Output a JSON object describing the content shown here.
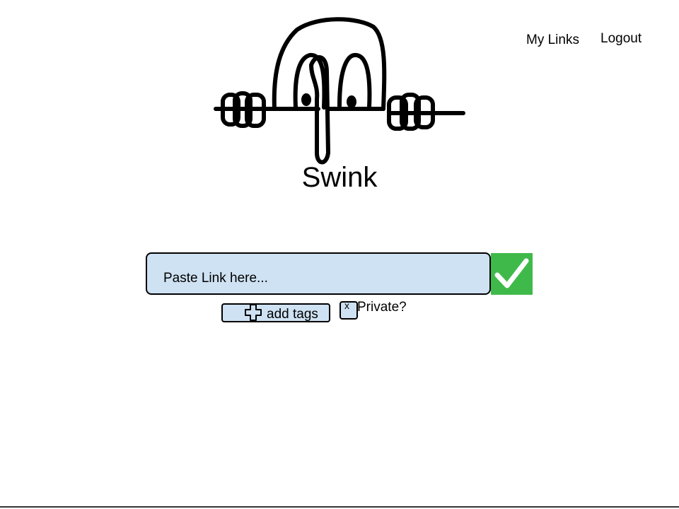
{
  "app": {
    "name": "Swink"
  },
  "nav": {
    "my_links": "My Links",
    "logout": "Logout"
  },
  "link_form": {
    "placeholder": "Paste Link here...",
    "value": "",
    "submit_icon": "checkmark-icon",
    "add_tags_label": "add tags",
    "add_tags_icon": "plus-icon",
    "private_label": "Private?",
    "private_mark": "x",
    "private_checked": true
  },
  "colors": {
    "input_background": "#cfe2f3",
    "submit_background": "#3fba4a",
    "text": "#000000"
  }
}
